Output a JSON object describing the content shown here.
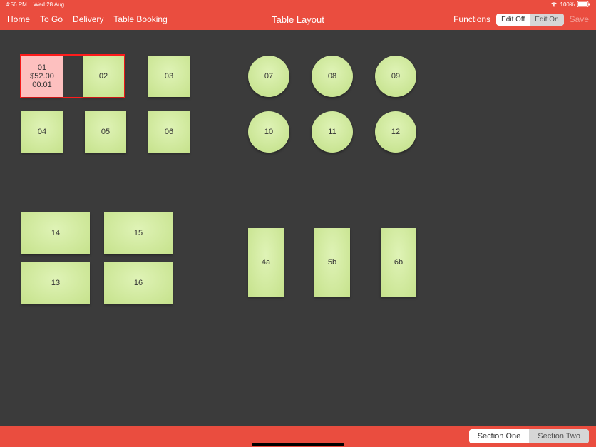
{
  "status": {
    "time": "4:56 PM",
    "date": "Wed 28 Aug",
    "battery": "100%"
  },
  "nav": {
    "home": "Home",
    "togo": "To Go",
    "delivery": "Delivery",
    "booking": "Table Booking",
    "title": "Table Layout",
    "functions": "Functions",
    "edit_off": "Edit Off",
    "edit_on": "Edit On",
    "save": "Save"
  },
  "tables": {
    "t01": {
      "label": "01",
      "amount": "$52.00",
      "elapsed": "00:01"
    },
    "t02": "02",
    "t03": "03",
    "t04": "04",
    "t05": "05",
    "t06": "06",
    "t07": "07",
    "t08": "08",
    "t09": "09",
    "t10": "10",
    "t11": "11",
    "t12": "12",
    "t13": "13",
    "t14": "14",
    "t15": "15",
    "t16": "16",
    "t4a": "4a",
    "t5b": "5b",
    "t6b": "6b"
  },
  "sections": {
    "one": "Section One",
    "two": "Section Two"
  }
}
